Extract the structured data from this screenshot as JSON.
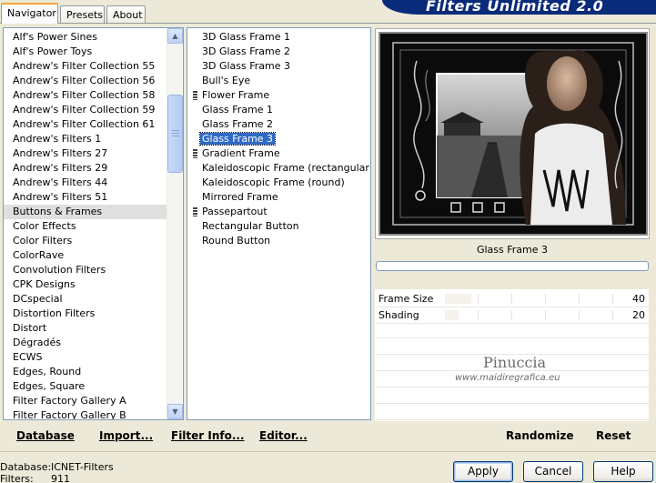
{
  "tabs": [
    {
      "label": "Navigator",
      "active": true
    },
    {
      "label": "Presets",
      "active": false
    },
    {
      "label": "About",
      "active": false
    }
  ],
  "banner": {
    "title": "Filters Unlimited 2.0"
  },
  "categories": {
    "items": [
      "Alf's Power Sines",
      "Alf's Power Toys",
      "Andrew's Filter Collection 55",
      "Andrew's Filter Collection 56",
      "Andrew's Filter Collection 58",
      "Andrew's Filter Collection 59",
      "Andrew's Filter Collection 61",
      "Andrew's Filters 1",
      "Andrew's Filters 27",
      "Andrew's Filters 29",
      "Andrew's Filters 44",
      "Andrew's Filters 51",
      "Buttons & Frames",
      "Color Effects",
      "Color Filters",
      "ColorRave",
      "Convolution Filters",
      "CPK Designs",
      "DCspecial",
      "Distortion Filters",
      "Distort",
      "Dégradés",
      "ECWS",
      "Edges, Round",
      "Edges, Square",
      "Filter Factory Gallery A",
      "Filter Factory Gallery B"
    ],
    "selected_index": 12
  },
  "filters": {
    "items": [
      {
        "label": "3D Glass Frame 1",
        "group": false
      },
      {
        "label": "3D Glass Frame 2",
        "group": false
      },
      {
        "label": "3D Glass Frame 3",
        "group": false
      },
      {
        "label": "Bull's Eye",
        "group": false
      },
      {
        "label": "Flower Frame",
        "group": true
      },
      {
        "label": "Glass Frame 1",
        "group": false
      },
      {
        "label": "Glass Frame 2",
        "group": false
      },
      {
        "label": "Glass Frame 3",
        "group": false
      },
      {
        "label": "Gradient Frame",
        "group": true
      },
      {
        "label": "Kaleidoscopic Frame (rectangular)",
        "group": false
      },
      {
        "label": "Kaleidoscopic Frame (round)",
        "group": false
      },
      {
        "label": "Mirrored Frame",
        "group": false
      },
      {
        "label": "Passepartout",
        "group": true
      },
      {
        "label": "Rectangular Button",
        "group": false
      },
      {
        "label": "Round Button",
        "group": false
      }
    ],
    "selected_index": 7
  },
  "preview": {
    "filter_name": "Glass Frame 3"
  },
  "params": [
    {
      "label": "Frame Size",
      "value": "40",
      "fraction": 0.157
    },
    {
      "label": "Shading",
      "value": "20",
      "fraction": 0.078
    }
  ],
  "watermark": {
    "name": "Pinuccia",
    "url": "www.maidiregrafica.eu"
  },
  "actions": {
    "database": "Database",
    "import": "Import...",
    "filter_info": "Filter Info...",
    "editor": "Editor...",
    "randomize": "Randomize",
    "reset": "Reset"
  },
  "status": {
    "database_label": "Database:",
    "database_value": "ICNET-Filters",
    "filters_label": "Filters:",
    "filters_value": "911"
  },
  "dialog_buttons": {
    "apply": "Apply",
    "cancel": "Cancel",
    "help": "Help"
  }
}
